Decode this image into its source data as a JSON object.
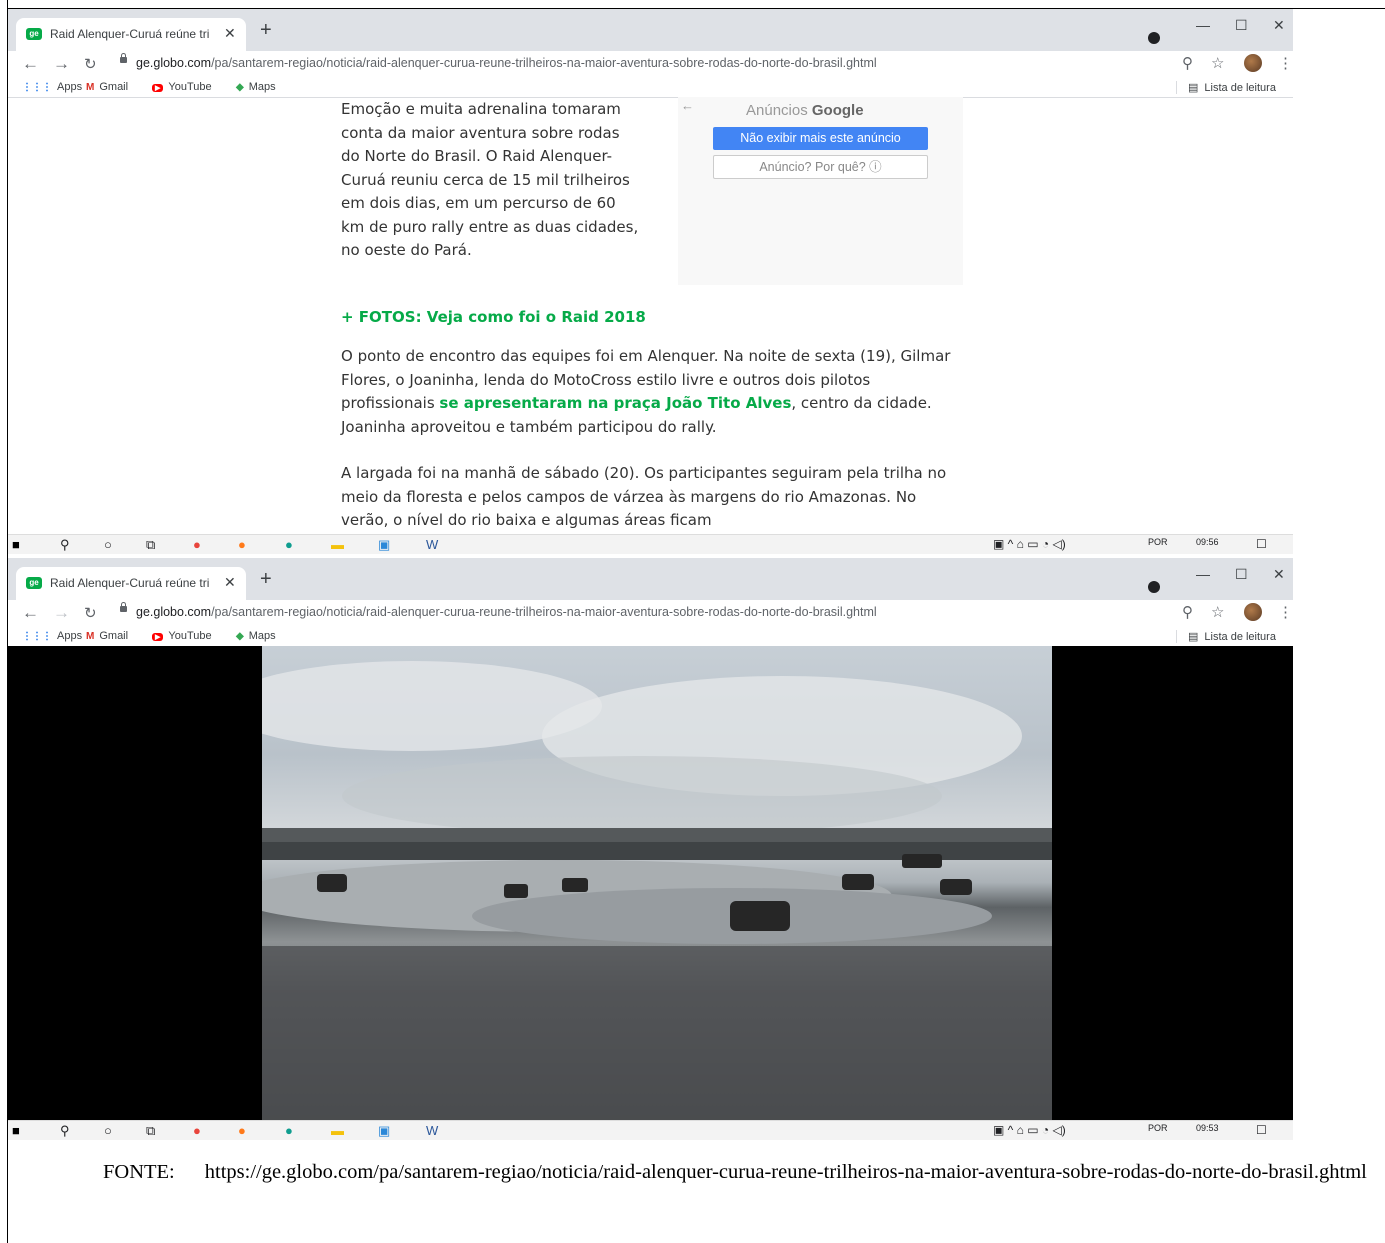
{
  "browser": {
    "tab_title": "Raid Alenquer-Curuá reúne trilhe",
    "tab_favicon": "ge",
    "new_tab": "+",
    "tab_close": "✕",
    "url_domain": "ge.globo.com",
    "url_path": "/pa/santarem-regiao/noticia/raid-alenquer-curua-reune-trilheiros-na-maior-aventura-sobre-rodas-do-norte-do-brasil.ghtml",
    "bookmarks": [
      {
        "label": "Apps",
        "icon": "apps-grid-icon"
      },
      {
        "label": "Gmail",
        "icon": "gmail-icon"
      },
      {
        "label": "YouTube",
        "icon": "youtube-icon"
      },
      {
        "label": "Maps",
        "icon": "maps-icon"
      }
    ],
    "reading_list": "Lista de leitura",
    "win_minimize": "—",
    "win_maximize": "☐",
    "win_close": "✕"
  },
  "article": {
    "lead": "Emoção e muita adrenalina tomaram conta da maior aventura sobre rodas do Norte do Brasil. O Raid Alenquer-Curuá reuniu cerca de 15 mil trilheiros em dois dias, em um percurso de 60 km de puro rally entre as duas cidades, no oeste do Pará.",
    "fotos_link": "+ FOTOS: Veja como foi o Raid 2018",
    "p1_a": "O ponto de encontro das equipes foi em Alenquer. Na noite de sexta (19), Gilmar Flores, o Joaninha, lenda do MotoCross estilo livre e outros dois pilotos profissionais ",
    "p1_link": "se apresentaram na praça João Tito Alves",
    "p1_b": ", centro da cidade. Joaninha aproveitou e também participou do rally.",
    "p2": "A largada foi na manhã de sábado (20). Os participantes seguiram pela trilha no meio da floresta e pelos campos de várzea às margens do rio Amazonas. No verão, o nível do rio baixa e algumas áreas ficam"
  },
  "ad": {
    "label_prefix": "Anúncios",
    "label_brand": "Google",
    "hide_button": "Não exibir mais este anúncio",
    "why_button": "Anúncio? Por quê? ⓘ"
  },
  "taskbar_top": {
    "lang": "POR",
    "time": "09:56"
  },
  "taskbar_bottom": {
    "lang": "POR",
    "time": "09:53"
  },
  "caption": {
    "label": "FONTE:",
    "url": "https://ge.globo.com/pa/santarem-regiao/noticia/raid-alenquer-curua-reune-trilheiros-na-maior-aventura-sobre-rodas-do-norte-do-brasil.ghtml"
  }
}
